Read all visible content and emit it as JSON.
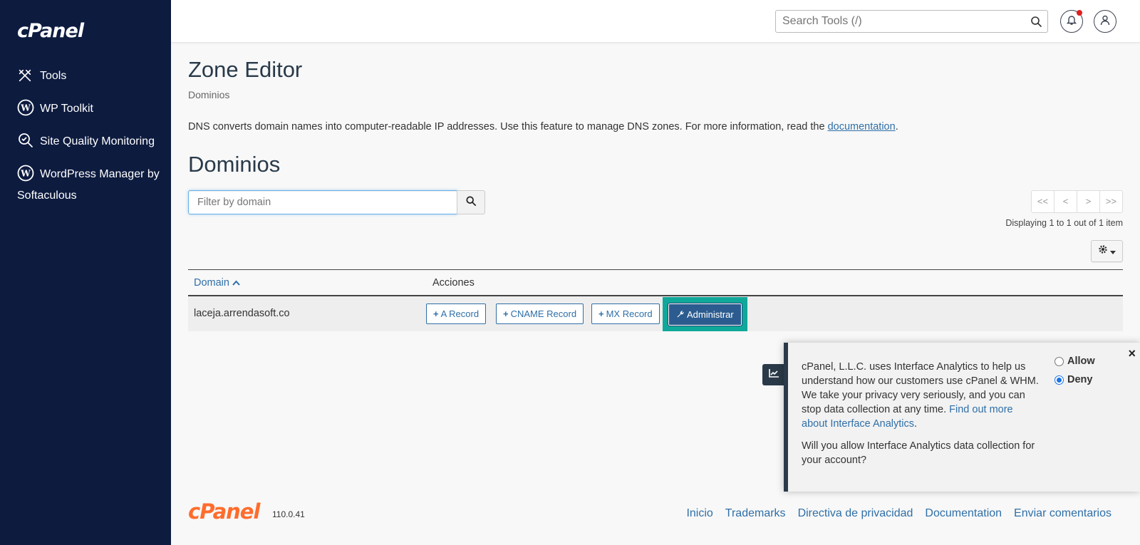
{
  "sidebar": {
    "logo": "cPanel",
    "items": [
      {
        "label": "Tools",
        "icon": "tools-icon"
      },
      {
        "label": "WP Toolkit",
        "icon": "wordpress-icon"
      },
      {
        "label": "Site Quality Monitoring",
        "icon": "site-quality-icon"
      },
      {
        "label": "WordPress Manager by Softaculous",
        "icon": "wordpress-icon"
      }
    ]
  },
  "header": {
    "search_placeholder": "Search Tools (/)"
  },
  "page": {
    "title": "Zone Editor",
    "breadcrumb": "Dominios",
    "description": "DNS converts domain names into computer-readable IP addresses. Use this feature to manage DNS zones. For more information, read the ",
    "doc_link": "documentation",
    "desc_end": ".",
    "section_title": "Dominios"
  },
  "filter": {
    "placeholder": "Filter by domain"
  },
  "pager": {
    "first": "<<",
    "prev": "<",
    "next": ">",
    "last": ">>",
    "display_text": "Displaying 1 to 1 out of 1 item"
  },
  "table": {
    "col_domain": "Domain",
    "col_actions": "Acciones",
    "rows": [
      {
        "domain": "laceja.arrendasoft.co",
        "a_record": "A Record",
        "cname_record": "CNAME Record",
        "mx_record": "MX Record",
        "manage": "Administrar"
      }
    ]
  },
  "analytics": {
    "text": "cPanel, L.L.C. uses Interface Analytics to help us understand how our customers use cPanel & WHM. We take your privacy very seriously, and you can stop data collection at any time. ",
    "link": "Find out more about Interface Analytics",
    "link_end": ".",
    "question": "Will you allow Interface Analytics data collection for your account?",
    "allow": "Allow",
    "deny": "Deny",
    "selected": "Deny",
    "close": "×"
  },
  "footer": {
    "logo": "cPanel",
    "version": "110.0.41",
    "links": [
      "Inicio",
      "Trademarks",
      "Directiva de privacidad",
      "Documentation",
      "Enviar comentarios"
    ]
  },
  "colors": {
    "sidebar_bg": "#0d1b3f",
    "link": "#2f6fa7",
    "brand_orange": "#ff6c2c",
    "highlight_teal": "#10a89a",
    "primary_button": "#2c5c8f"
  }
}
